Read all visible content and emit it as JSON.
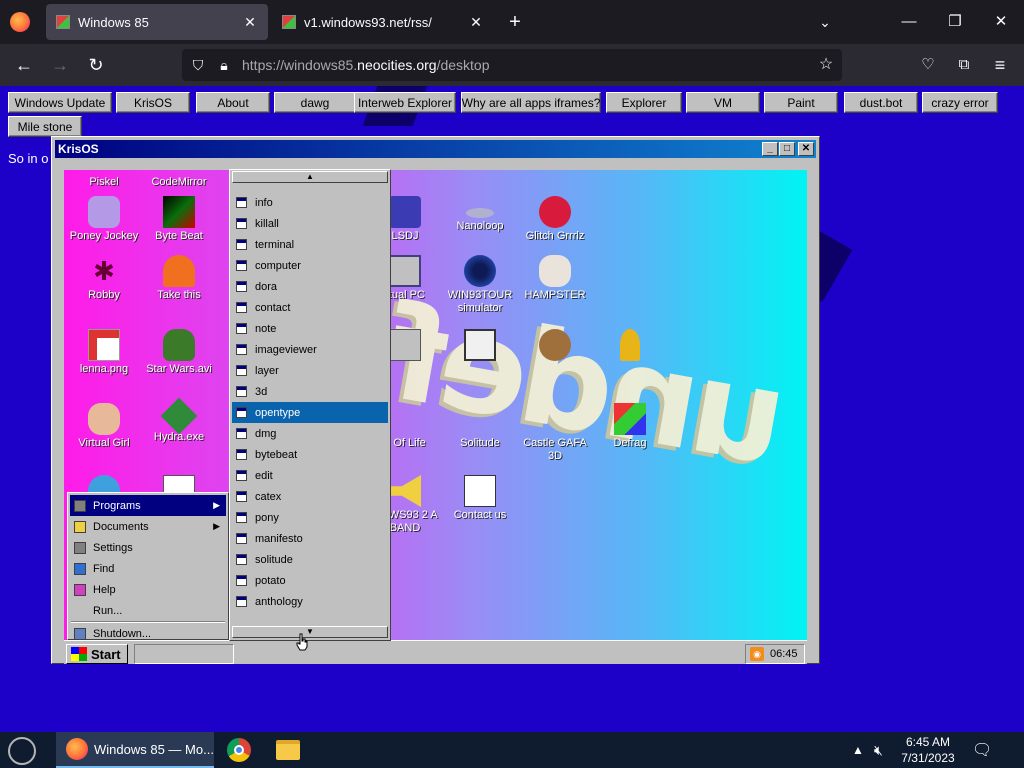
{
  "browser": {
    "tabs": [
      {
        "label": "Windows 85",
        "active": true
      },
      {
        "label": "v1.windows93.net/rss/",
        "active": false
      }
    ],
    "new_tab_glyph": "+",
    "url_prefix": "https://windows85.",
    "url_domain": "neocities.org",
    "url_path": "/desktop"
  },
  "page": {
    "nav_buttons": [
      "Windows Update",
      "KrisOS",
      "About",
      "dawg",
      "Interweb Explorer",
      "Why are all apps iframes?",
      "Explorer",
      "VM",
      "Paint",
      "dust.bot",
      "crazy error",
      "Mile stone"
    ],
    "intro_text": "So in o"
  },
  "krisos": {
    "title": "KrisOS",
    "desktop_icons": [
      {
        "label": "Piskel"
      },
      {
        "label": "CodeMirror"
      },
      {
        "label": "Poney Jockey"
      },
      {
        "label": "Byte Beat"
      },
      {
        "label": "Robby"
      },
      {
        "label": "Take this"
      },
      {
        "label": "lenna.png"
      },
      {
        "label": "Star Wars.avi"
      },
      {
        "label": "Virtual Girl"
      },
      {
        "label": "Hydra.exe"
      },
      {
        "label": "LSDJ"
      },
      {
        "label": "Nanoloop"
      },
      {
        "label": "Glitch Grrrlz"
      },
      {
        "label": "rtual PC"
      },
      {
        "label": "WIN93TOUR simulator"
      },
      {
        "label": "HAMPSTER"
      },
      {
        "label": "e Of Life"
      },
      {
        "label": "Solitude"
      },
      {
        "label": "Castle GAFA 3D"
      },
      {
        "label": "Defrag"
      },
      {
        "label": "DOWS93 2 A BAND"
      },
      {
        "label": "Contact us"
      }
    ],
    "overlay_text": "undef",
    "start_label": "Start",
    "clock": "06:45",
    "start_menu": [
      {
        "label": "Programs",
        "has_submenu": true
      },
      {
        "label": "Documents",
        "has_submenu": true
      },
      {
        "label": "Settings",
        "has_submenu": false
      },
      {
        "label": "Find",
        "has_submenu": false
      },
      {
        "label": "Help",
        "has_submenu": false
      },
      {
        "label": "Run...",
        "has_submenu": false
      },
      {
        "label": "Shutdown...",
        "has_submenu": false
      }
    ],
    "programs": [
      "info",
      "killall",
      "terminal",
      "computer",
      "dora",
      "contact",
      "note",
      "imageviewer",
      "layer",
      "3d",
      "opentype",
      "dmg",
      "bytebeat",
      "edit",
      "catex",
      "pony",
      "manifesto",
      "solitude",
      "potato",
      "anthology"
    ],
    "programs_selected": "opentype"
  },
  "os_taskbar": {
    "firefox_label": "Windows 85 — Mo...",
    "time": "6:45 AM",
    "date": "7/31/2023"
  },
  "colors": {
    "page_bg": "#1d01c9",
    "title_gradient_start": "#000080",
    "title_gradient_end": "#1084d0",
    "highlight": "#000080"
  }
}
